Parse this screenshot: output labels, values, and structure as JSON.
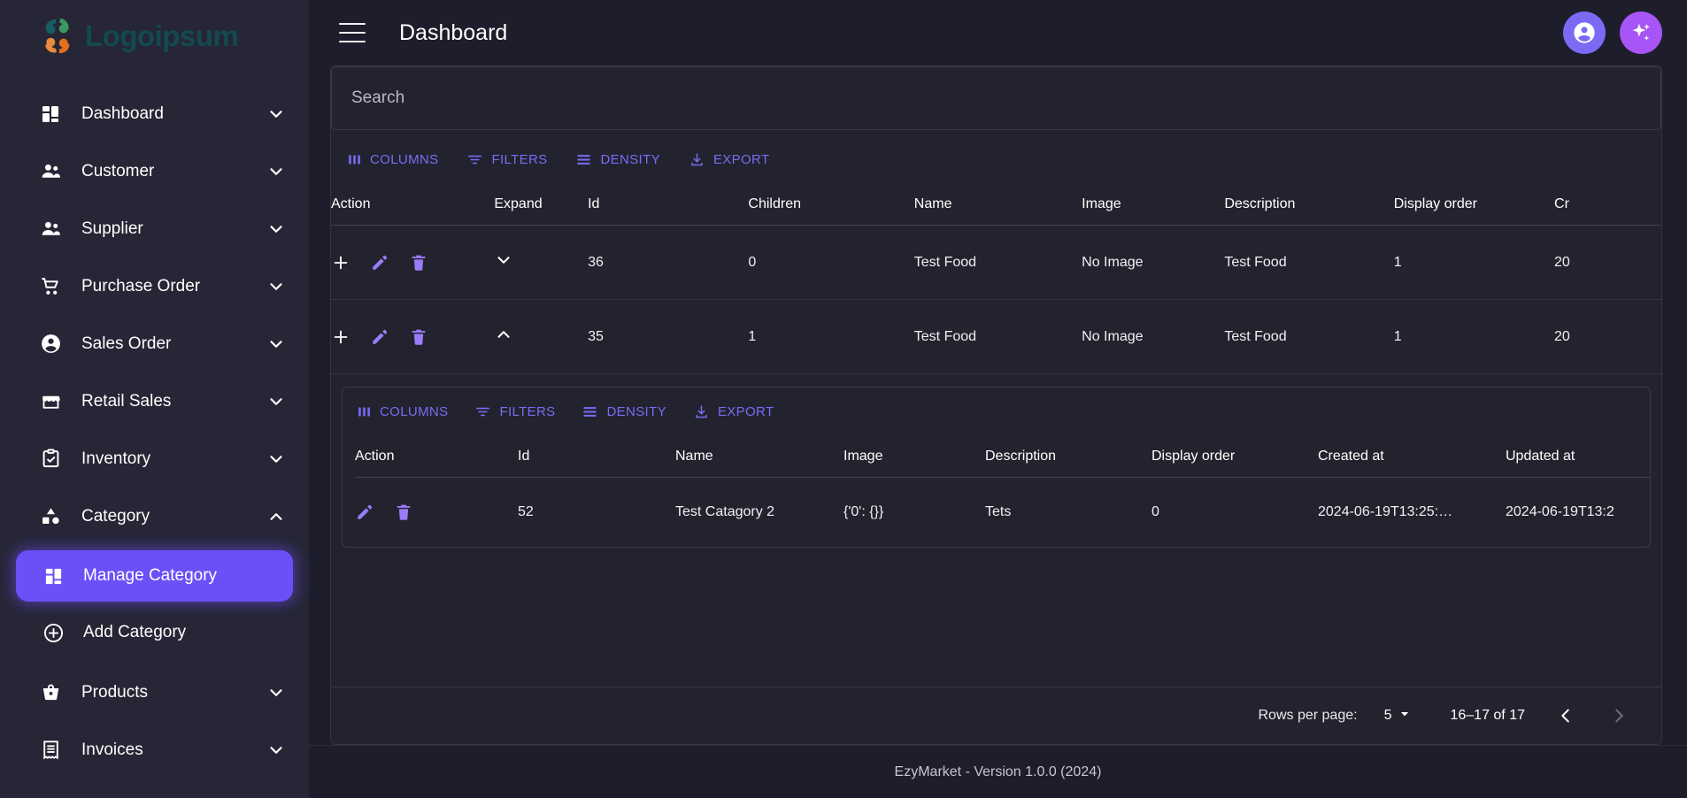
{
  "brand": {
    "name": "Logoipsum",
    "logo_icon": "logoipsum-flower-icon"
  },
  "sidebar": {
    "items": [
      {
        "label": "Dashboard",
        "icon": "dashboard-grid-icon",
        "chevron": "chevron-down-icon"
      },
      {
        "label": "Customer",
        "icon": "people-icon",
        "chevron": "chevron-down-icon"
      },
      {
        "label": "Supplier",
        "icon": "people-icon",
        "chevron": "chevron-down-icon"
      },
      {
        "label": "Purchase Order",
        "icon": "shopping-cart-icon",
        "chevron": "chevron-down-icon"
      },
      {
        "label": "Sales Order",
        "icon": "account-circle-icon",
        "chevron": "chevron-down-icon"
      },
      {
        "label": "Retail Sales",
        "icon": "storefront-icon",
        "chevron": "chevron-down-icon"
      },
      {
        "label": "Inventory",
        "icon": "clipboard-check-icon",
        "chevron": "chevron-down-icon"
      },
      {
        "label": "Category",
        "icon": "shapes-icon",
        "chevron": "chevron-up-icon"
      }
    ],
    "category_children": [
      {
        "label": "Manage Category",
        "icon": "dashboard-grid-icon",
        "active": true
      },
      {
        "label": "Add Category",
        "icon": "plus-circle-icon",
        "active": false
      }
    ],
    "items_after": [
      {
        "label": "Products",
        "icon": "basket-icon",
        "chevron": "chevron-down-icon"
      },
      {
        "label": "Invoices",
        "icon": "receipt-icon",
        "chevron": "chevron-down-icon"
      }
    ]
  },
  "topbar": {
    "menu_icon": "hamburger-menu-icon",
    "title": "Dashboard",
    "account_icon": "account-circle-icon",
    "ai_icon": "sparkles-icon"
  },
  "search": {
    "value": "",
    "placeholder": "Search"
  },
  "toolbar": {
    "columns": "COLUMNS",
    "filters": "FILTERS",
    "density": "DENSITY",
    "export": "EXPORT"
  },
  "outer_table": {
    "columns": [
      "Action",
      "Expand",
      "Id",
      "Children",
      "Name",
      "Image",
      "Description",
      "Display order",
      "Cr"
    ],
    "rows": [
      {
        "expand": "chevron-down-icon",
        "id": "36",
        "children": "0",
        "name": "Test Food",
        "image": "No Image",
        "description": "Test Food",
        "display_order": "1",
        "created_at": "20"
      },
      {
        "expand": "chevron-up-icon",
        "id": "35",
        "children": "1",
        "name": "Test Food",
        "image": "No Image",
        "description": "Test Food",
        "display_order": "1",
        "created_at": "20"
      }
    ]
  },
  "nested_table": {
    "columns": [
      "Action",
      "Id",
      "Name",
      "Image",
      "Description",
      "Display order",
      "Created at",
      "Updated at"
    ],
    "rows": [
      {
        "id": "52",
        "name": "Test Catagory 2",
        "image": "{'0': {}}",
        "description": "Tets",
        "display_order": "0",
        "created_at": "2024-06-19T13:25:…",
        "updated_at": "2024-06-19T13:2"
      }
    ]
  },
  "pagination": {
    "rows_per_page_label": "Rows per page:",
    "rows_per_page_value": "5",
    "range_label": "16–17 of 17",
    "prev_icon": "chevron-left-icon",
    "next_icon": "chevron-right-icon"
  },
  "footer": {
    "text": "EzyMarket - Version 1.0.0 (2024)"
  },
  "colors": {
    "accent": "#7c6af5",
    "sidebar_bg": "#262636",
    "content_bg": "#1d1d2b",
    "panel_bg": "#23232f",
    "ai_button": "#a855f7"
  }
}
